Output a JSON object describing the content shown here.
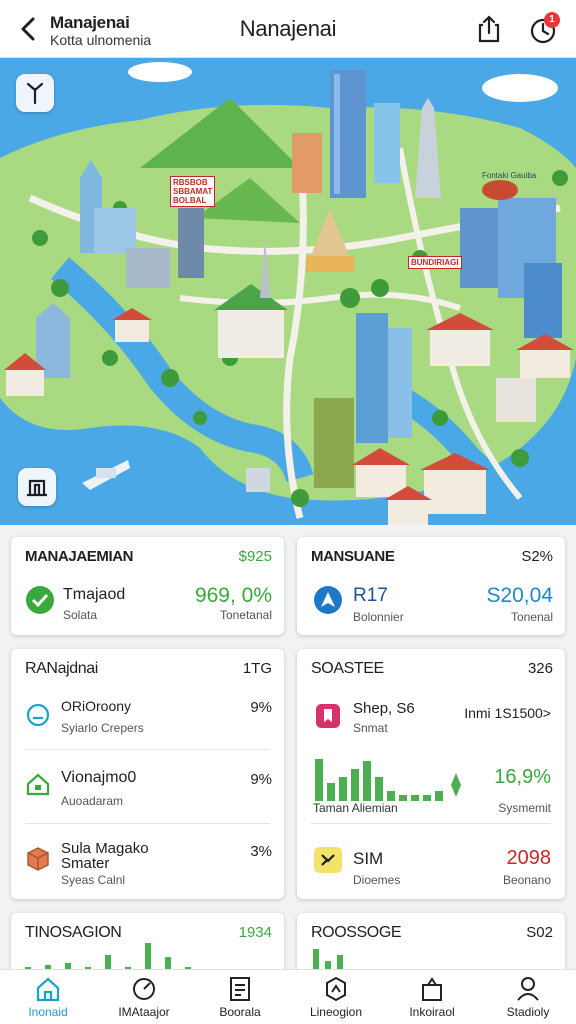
{
  "header": {
    "location_title": "Manajenai",
    "location_subtitle": "Kotta ulnomenia",
    "app_title": "Nanajenai",
    "notification_count": "1"
  },
  "map": {
    "sign_1": "RBSBOB\nSBBAMAT\nBOLBAL",
    "sign_2": "BUNDIRIAGI",
    "caption": "Fontaki Gauiba"
  },
  "cards": {
    "c1": {
      "title": "MANAJAEMIAN",
      "value": "$925",
      "label": "Tmajaod",
      "sub": "Solata",
      "big": "969, 0%",
      "big_sub": "Tonetanal",
      "big_color": "#3aa83a"
    },
    "c2": {
      "title": "MANSUANE",
      "value": "S2%",
      "label": "R17",
      "sub": "Bolonnier",
      "big": "S20,04",
      "big_sub": "Tonenal",
      "big_color": "#1e88c8"
    },
    "c3": {
      "title": "RANajdnai",
      "value": "1TG",
      "items": [
        {
          "label": "ORiOroony",
          "sub": "Syiarlo Crepers",
          "pct": "9%"
        },
        {
          "label": "Vionajmo0",
          "sub": "Auoadaram",
          "pct": "9%"
        },
        {
          "label": "Sula Magako\nSmater",
          "sub": "Syeas Calnl",
          "pct": "3%"
        }
      ]
    },
    "c4": {
      "title": "SOASTEE",
      "value": "326",
      "i1": {
        "label": "Shep, S6",
        "sub": "Snmat",
        "right": "Inmi 1S1500>"
      },
      "chart_caption": "Taman Aliemian",
      "chart_pct": "16,9%",
      "chart_sub": "Sysmemit",
      "i3": {
        "label": "SIM",
        "sub": "Dioemes",
        "value": "2098",
        "value_sub": "Beonano",
        "value_color": "#c62828"
      }
    },
    "c5": {
      "title": "TINOSAGION",
      "value": "1934"
    },
    "c6": {
      "title": "ROOSSOGE",
      "value": "S02"
    }
  },
  "nav": [
    {
      "label": "Inonaid"
    },
    {
      "label": "IMAtaajor"
    },
    {
      "label": "Boorala"
    },
    {
      "label": "Lineogion"
    },
    {
      "label": "Inkoiraol"
    },
    {
      "label": "Stadioly"
    }
  ],
  "colors": {
    "accent": "#1aa3c8",
    "green": "#3aa83a",
    "blue": "#1e88c8",
    "red": "#c62828"
  },
  "icons": {
    "back": "chevron-left-icon",
    "share": "share-icon",
    "notification": "bell-icon",
    "map_top": "pin-icon",
    "map_bottom": "building-icon"
  }
}
